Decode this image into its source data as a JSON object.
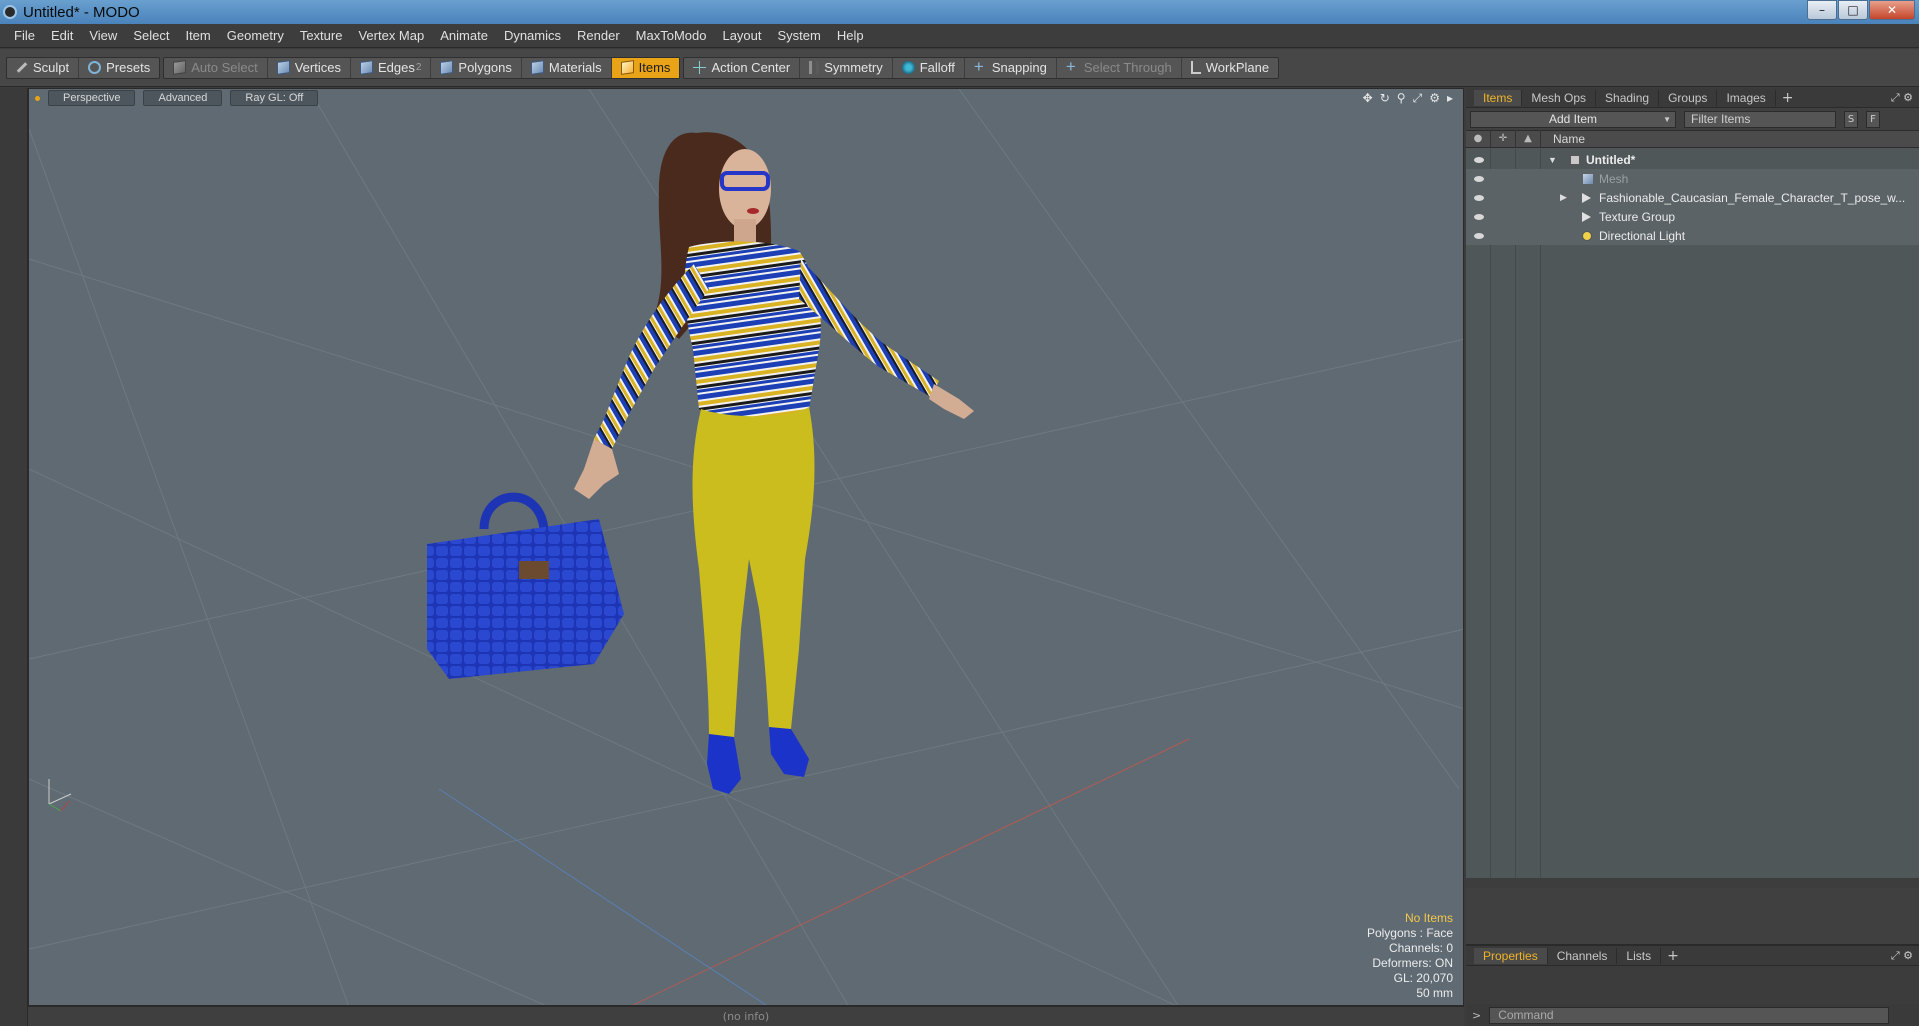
{
  "window": {
    "title": "Untitled* - MODO",
    "minimize": "–",
    "maximize": "□",
    "close": "✕"
  },
  "menu": [
    "File",
    "Edit",
    "View",
    "Select",
    "Item",
    "Geometry",
    "Texture",
    "Vertex Map",
    "Animate",
    "Dynamics",
    "Render",
    "MaxToModo",
    "Layout",
    "System",
    "Help"
  ],
  "toolbar": {
    "sculpt": "Sculpt",
    "presets": "Presets",
    "auto_select": "Auto Select",
    "vertices": "Vertices",
    "edges": "Edges",
    "edges_count": "2",
    "polygons": "Polygons",
    "materials": "Materials",
    "items": "Items",
    "action_center": "Action Center",
    "symmetry": "Symmetry",
    "falloff": "Falloff",
    "snapping": "Snapping",
    "select_through": "Select Through",
    "workplane": "WorkPlane"
  },
  "viewport": {
    "view_mode": "Perspective",
    "shading": "Advanced",
    "raygl": "Ray GL: Off",
    "info": {
      "selection": "No Items",
      "polygons": "Polygons : Face",
      "channels": "Channels: 0",
      "deformers": "Deformers: ON",
      "gl": "GL: 20,070",
      "focal": "50 mm"
    },
    "tool_icons": [
      "✥",
      "↻",
      "⚲",
      "⤢",
      "⚙",
      "▸"
    ]
  },
  "status": "(no info)",
  "panel": {
    "tabs": [
      "Items",
      "Mesh Ops",
      "Shading",
      "Groups",
      "Images"
    ],
    "active_tab": "Items",
    "add_item": "Add Item",
    "filter_placeholder": "Filter Items",
    "s_btn": "S",
    "f_btn": "F",
    "name_header": "Name",
    "tree": [
      {
        "label": "Untitled*",
        "icon": "scene-icon"
      },
      {
        "label": "Mesh",
        "icon": "mesh-icon"
      },
      {
        "label": "Fashionable_Caucasian_Female_Character_T_pose_w...",
        "icon": "locator-icon"
      },
      {
        "label": "Texture Group",
        "icon": "locator-icon"
      },
      {
        "label": "Directional Light",
        "icon": "light-icon"
      }
    ],
    "bottom_tabs": [
      "Properties",
      "Channels",
      "Lists"
    ],
    "command_placeholder": "Command",
    "command_prompt": ">"
  },
  "colors": {
    "accent": "#e8a317",
    "viewport_bg": "#5f6a73",
    "sweater_blue": "#1c3fb5",
    "sweater_yellow": "#d9b323",
    "pants": "#cbbd1d",
    "bag": "#1d35b4"
  }
}
